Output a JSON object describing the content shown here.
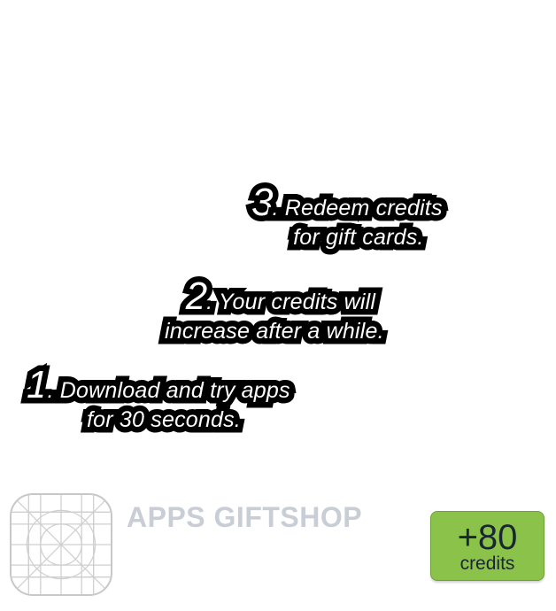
{
  "steps": {
    "step3": {
      "number": "3",
      "line1": ". Redeem credits",
      "line2": "for gift cards."
    },
    "step2": {
      "number": "2",
      "line1": ". Your credits will",
      "line2": "increase after a while."
    },
    "step1": {
      "number": "1",
      "line1": ". Download and try apps",
      "line2": "for 30 seconds."
    }
  },
  "brand": {
    "name": "APPS GIFTSHOP",
    "color": "#c9ced6"
  },
  "credits_badge": {
    "amount": "+80",
    "unit": "credits",
    "color": "#8bc34a"
  },
  "icons": {
    "app_icon": "app-icon-grid-template"
  }
}
